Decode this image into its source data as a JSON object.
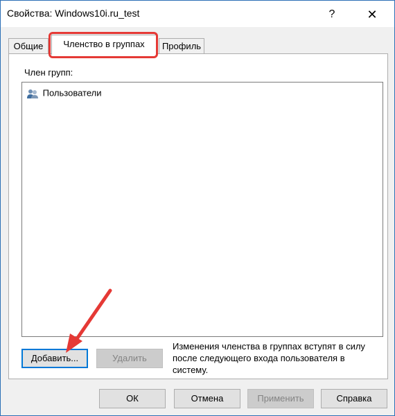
{
  "window": {
    "title": "Свойства: Windows10i.ru_test",
    "help_glyph": "?",
    "close_glyph": "✕"
  },
  "tabs": [
    {
      "label": "Общие",
      "selected": false
    },
    {
      "label": "Членство в группах",
      "selected": true
    },
    {
      "label": "Профиль",
      "selected": false
    }
  ],
  "members": {
    "label": "Член групп:",
    "items": [
      {
        "name": "Пользователи",
        "icon": "users-group-icon"
      }
    ]
  },
  "actions": {
    "add_label": "Добавить...",
    "remove_label": "Удалить"
  },
  "note": "Изменения членства в группах вступят в силу после следующего входа пользователя в систему.",
  "footer": {
    "ok_label": "ОК",
    "cancel_label": "Отмена",
    "apply_label": "Применить",
    "help_label": "Справка"
  },
  "colors": {
    "highlight": "#e53935",
    "accent": "#0078d7"
  }
}
